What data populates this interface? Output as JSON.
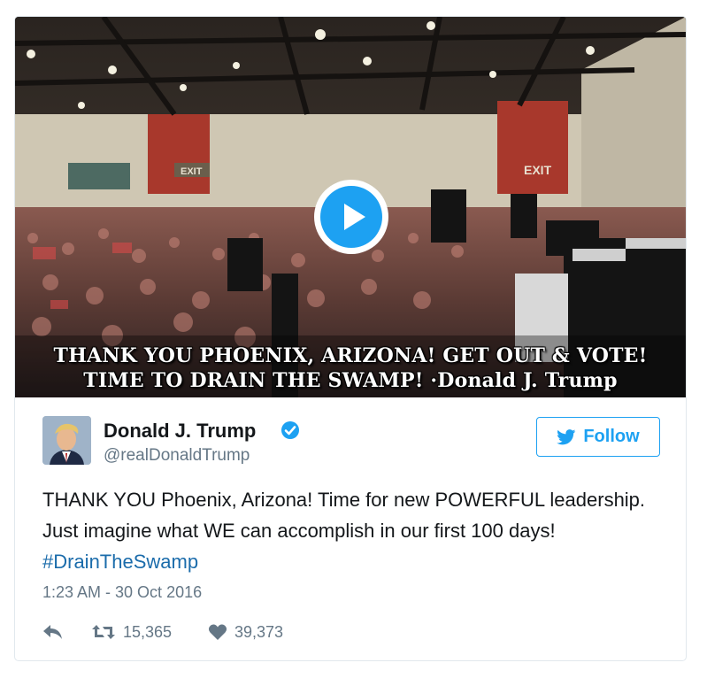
{
  "media": {
    "caption_line1": "THANK YOU PHOENIX, ARIZONA! GET OUT & VOTE!",
    "caption_line2": "TIME TO DRAIN THE SWAMP! ·Donald J. Trump",
    "exit_sign_left": "EXIT",
    "exit_sign_right": "EXIT",
    "play_icon": "play-icon"
  },
  "author": {
    "name": "Donald J. Trump",
    "handle": "@realDonaldTrump",
    "verified": true
  },
  "follow_button": {
    "label": "Follow",
    "icon": "twitter-bird-icon"
  },
  "tweet": {
    "text": "THANK YOU Phoenix, Arizona! Time for new POWERFUL leadership. Just imagine what WE can accomplish in our first 100 days! ",
    "hashtag": "#DrainTheSwamp",
    "timestamp": "1:23 AM - 30 Oct 2016"
  },
  "actions": {
    "retweets": "15,365",
    "likes": "39,373"
  },
  "colors": {
    "accent": "#1da1f2",
    "hashtag": "#1b6cab",
    "secondary_text": "#657786"
  }
}
